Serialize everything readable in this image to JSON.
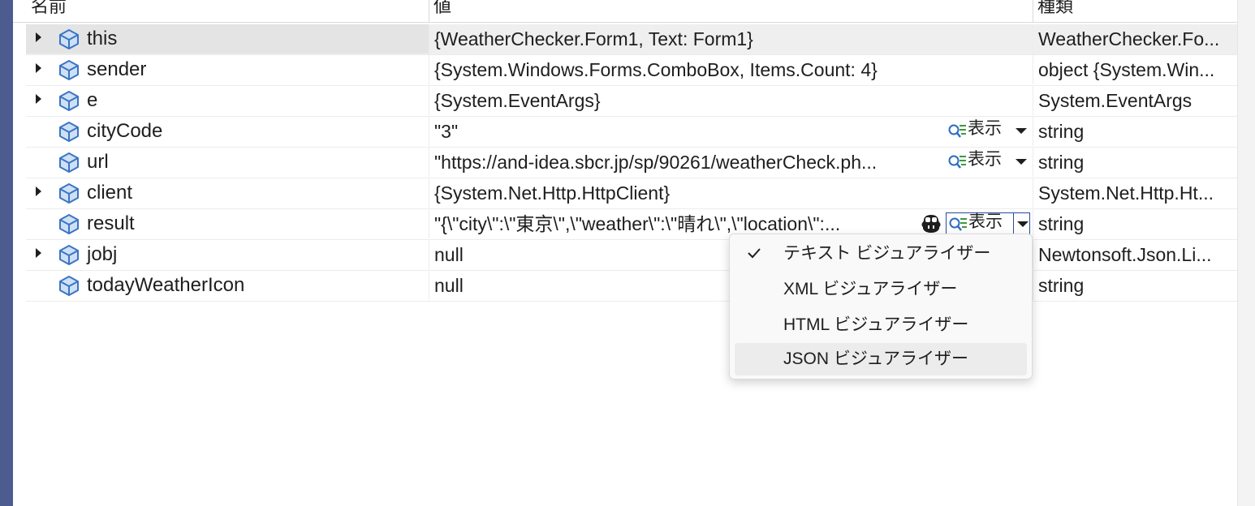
{
  "columns": {
    "name": "名前",
    "value": "値",
    "type": "種類"
  },
  "rows": [
    {
      "name": "this",
      "value": "{WeatherChecker.Form1, Text: Form1}",
      "type": "WeatherChecker.Fo...",
      "expandable": true,
      "selected": true
    },
    {
      "name": "sender",
      "value": "{System.Windows.Forms.ComboBox, Items.Count: 4}",
      "type": "object {System.Win...",
      "expandable": true
    },
    {
      "name": "e",
      "value": "{System.EventArgs}",
      "type": "System.EventArgs",
      "expandable": true
    },
    {
      "name": "cityCode",
      "value": "\"3\"",
      "type": "string",
      "expandable": false,
      "visualizer": "表示"
    },
    {
      "name": "url",
      "value": "\"https://and-idea.sbcr.jp/sp/90261/weatherCheck.ph...",
      "type": "string",
      "expandable": false,
      "visualizer": "表示"
    },
    {
      "name": "client",
      "value": "{System.Net.Http.HttpClient}",
      "type": "System.Net.Http.Ht...",
      "expandable": true
    },
    {
      "name": "result",
      "value": "\"{\\\"city\\\":\\\"東京\\\",\\\"weather\\\":\\\"晴れ\\\",\\\"location\\\":...",
      "type": "string",
      "expandable": false,
      "visualizer": "表示"
    },
    {
      "name": "jobj",
      "value": "null",
      "type": "Newtonsoft.Json.Li...",
      "expandable": true
    },
    {
      "name": "todayWeatherIcon",
      "value": "null",
      "type": "string",
      "expandable": false
    }
  ],
  "visualizer_menu": {
    "items": [
      {
        "label": "テキスト ビジュアライザー",
        "checked": true
      },
      {
        "label": "XML ビジュアライザー",
        "checked": false
      },
      {
        "label": "HTML ビジュアライザー",
        "checked": false
      },
      {
        "label": "JSON ビジュアライザー",
        "checked": false,
        "hover": true
      }
    ]
  },
  "colors": {
    "accent": "#2b4a9d",
    "icon_blue": "#3a75c4",
    "left_strip": "#4d5c8f"
  }
}
